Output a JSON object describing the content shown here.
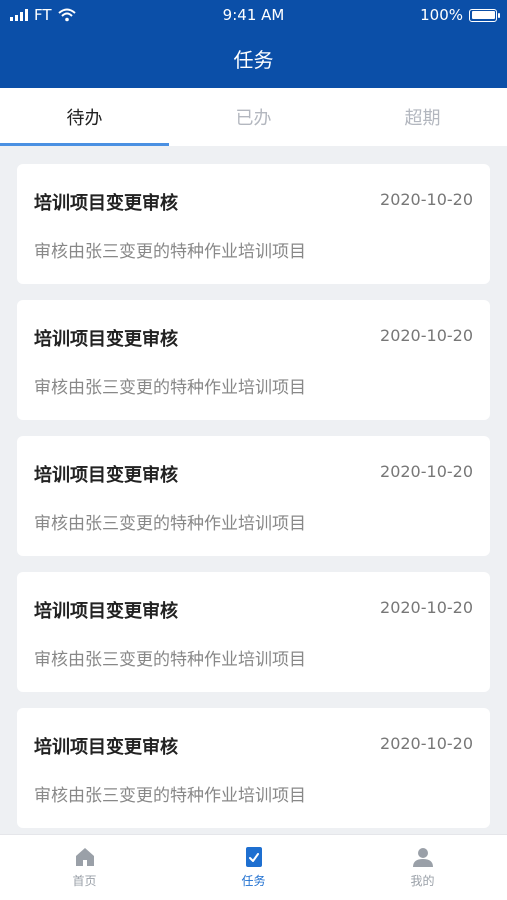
{
  "status_bar": {
    "carrier": "FT",
    "time": "9:41 AM",
    "battery": "100%"
  },
  "header": {
    "title": "任务"
  },
  "tabs": [
    {
      "label": "待办",
      "active": true
    },
    {
      "label": "已办",
      "active": false
    },
    {
      "label": "超期",
      "active": false
    }
  ],
  "tasks": [
    {
      "title": "培训项目变更审核",
      "date": "2020-10-20",
      "desc": "审核由张三变更的特种作业培训项目"
    },
    {
      "title": "培训项目变更审核",
      "date": "2020-10-20",
      "desc": "审核由张三变更的特种作业培训项目"
    },
    {
      "title": "培训项目变更审核",
      "date": "2020-10-20",
      "desc": "审核由张三变更的特种作业培训项目"
    },
    {
      "title": "培训项目变更审核",
      "date": "2020-10-20",
      "desc": "审核由张三变更的特种作业培训项目"
    },
    {
      "title": "培训项目变更审核",
      "date": "2020-10-20",
      "desc": "审核由张三变更的特种作业培训项目"
    }
  ],
  "bottom_nav": [
    {
      "label": "首页",
      "icon": "home-icon",
      "active": false
    },
    {
      "label": "任务",
      "icon": "task-icon",
      "active": true
    },
    {
      "label": "我的",
      "icon": "user-icon",
      "active": false
    }
  ],
  "colors": {
    "header_bg": "#0b4fa8",
    "accent": "#1e6fd0",
    "tab_indicator": "#4a90e2"
  }
}
